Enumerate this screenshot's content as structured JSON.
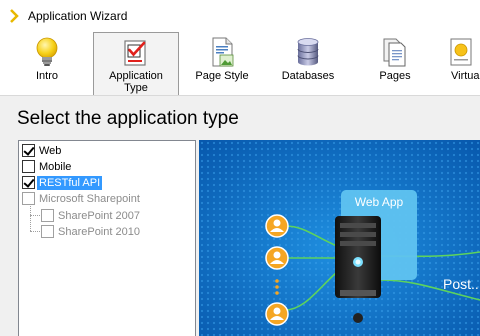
{
  "window": {
    "title": "Application Wizard"
  },
  "ribbon": {
    "tabs": [
      {
        "label": "Intro",
        "icon": "lightbulb-icon"
      },
      {
        "label": "Application Type",
        "icon": "checklist-icon",
        "active": true
      },
      {
        "label": "Page Style",
        "icon": "page-style-icon"
      },
      {
        "label": "Databases",
        "icon": "database-icon"
      },
      {
        "label": "Pages",
        "icon": "pages-icon"
      },
      {
        "label": "Virtual",
        "icon": "virtual-icon"
      }
    ]
  },
  "main": {
    "heading": "Select the application type",
    "tree": [
      {
        "label": "Web",
        "checked": true,
        "disabled": false
      },
      {
        "label": "Mobile",
        "checked": false,
        "disabled": false
      },
      {
        "label": "RESTful API",
        "checked": true,
        "disabled": false,
        "selected": true
      },
      {
        "label": "Microsoft Sharepoint",
        "checked": false,
        "disabled": true
      },
      {
        "label": "SharePoint 2007",
        "checked": false,
        "disabled": true
      },
      {
        "label": "SharePoint 2010",
        "checked": false,
        "disabled": true
      }
    ],
    "preview": {
      "server_label": "Web App",
      "caption": "Post...",
      "colors": {
        "background": "#0a68c4",
        "user": "#f5a623",
        "panel": "#5fc3f0",
        "server": "#1c1c1c"
      }
    }
  }
}
